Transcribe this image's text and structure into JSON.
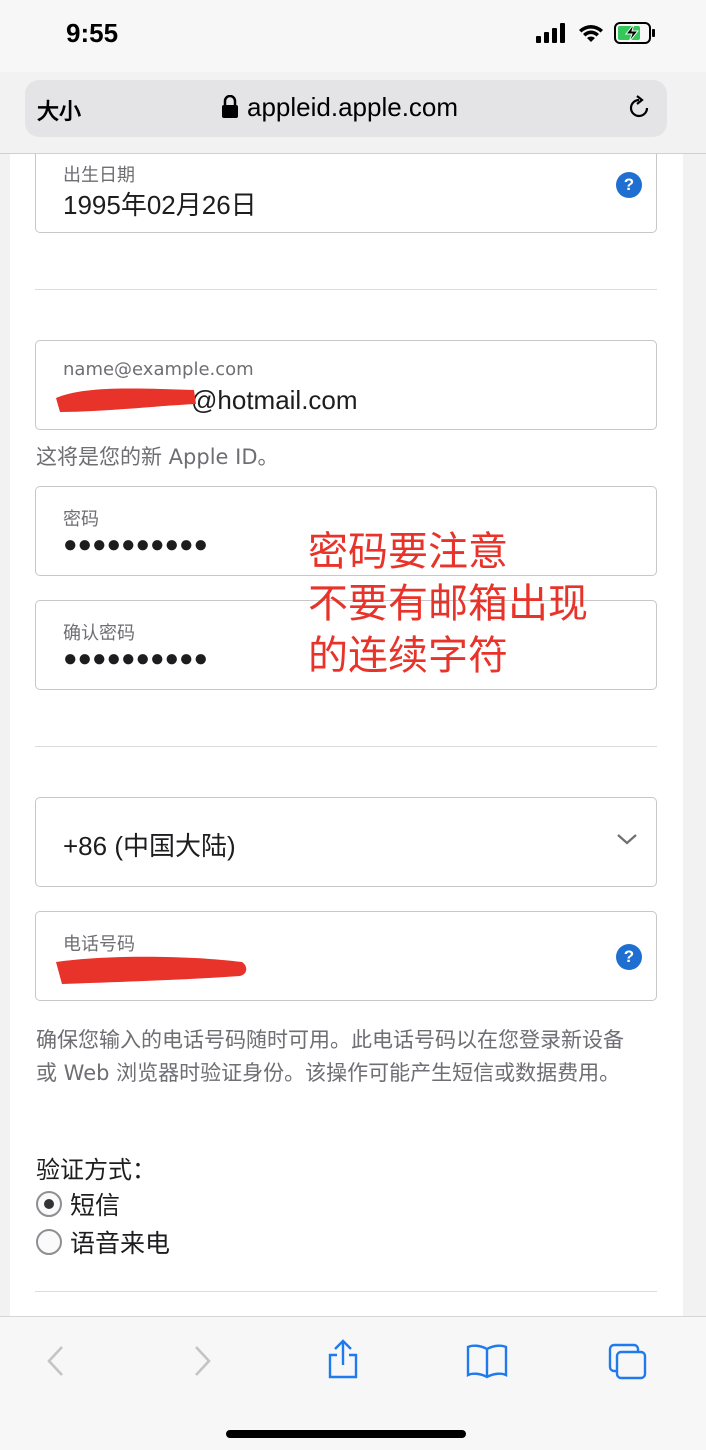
{
  "status_bar": {
    "time": "9:55",
    "battery_state": "charging"
  },
  "url_bar": {
    "text_size_label": "大小",
    "url": "appleid.apple.com"
  },
  "form": {
    "birthdate": {
      "label": "出生日期",
      "value": "1995年02月26日"
    },
    "email": {
      "label": "name@example.com",
      "value_visible": "@hotmail.com",
      "hint": "这将是您的新 Apple ID。"
    },
    "password": {
      "label": "密码",
      "value": "●●●●●●●●●●"
    },
    "confirm_password": {
      "label": "确认密码",
      "value": "●●●●●●●●●●"
    },
    "country_code": {
      "value": "+86 (中国大陆)"
    },
    "phone": {
      "label": "电话号码"
    },
    "phone_description": "确保您输入的电话号码随时可用。此电话号码以在您登录新设备或 Web 浏览器时验证身份。该操作可能产生短信或数据费用。",
    "verification": {
      "title": "验证方式：",
      "options": [
        {
          "label": "短信",
          "selected": true
        },
        {
          "label": "语音来电",
          "selected": false
        }
      ]
    }
  },
  "annotation": {
    "text": "密码要注意\n不要有邮箱出现\n的连续字符",
    "color": "#e8332a"
  },
  "colors": {
    "help_icon": "#1f6fd1",
    "toolbar_icon": "#1f7aed",
    "redaction": "#e8332a"
  }
}
